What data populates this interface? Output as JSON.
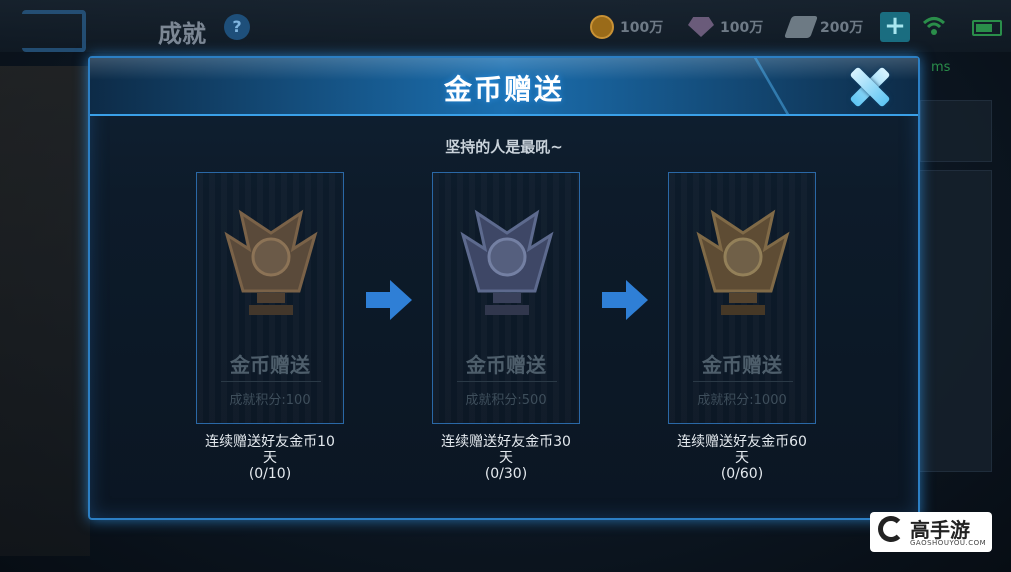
{
  "header": {
    "page_title": "成就",
    "help_label": "?",
    "resources": [
      {
        "icon": "gold-coin-icon",
        "value": "100万"
      },
      {
        "icon": "diamond-icon",
        "value": "100万"
      },
      {
        "icon": "voucher-icon",
        "value": "200万"
      }
    ],
    "ping": "ms"
  },
  "modal": {
    "title": "金币赠送",
    "subtitle": "坚持的人是最吼~",
    "cards": [
      {
        "title": "金币赠送",
        "score": "成就积分:100",
        "desc_line1": "连续赠送好友金币10",
        "desc_line2": "天",
        "progress": "(0/10)",
        "medal": "bronze"
      },
      {
        "title": "金币赠送",
        "score": "成就积分:500",
        "desc_line1": "连续赠送好友金币30",
        "desc_line2": "天",
        "progress": "(0/30)",
        "medal": "silver"
      },
      {
        "title": "金币赠送",
        "score": "成就积分:1000",
        "desc_line1": "连续赠送好友金币60",
        "desc_line2": "天",
        "progress": "(0/60)",
        "medal": "gold"
      }
    ]
  },
  "watermark": {
    "text": "高手游",
    "sub": "GAOSHOUYOU.COM"
  },
  "colors": {
    "accent": "#2c7fc4",
    "header": "#1b6fb0",
    "arrow": "#2f7fd6"
  }
}
